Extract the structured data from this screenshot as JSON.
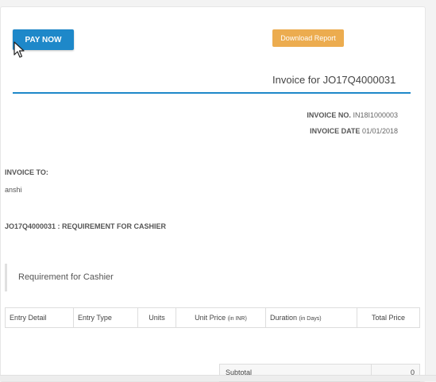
{
  "toolbar": {
    "pay_now_label": "PAY NOW",
    "download_label": "Download Report"
  },
  "invoice": {
    "title": "Invoice for JO17Q4000031",
    "number_label": "INVOICE NO.",
    "number_value": "IN18I1000003",
    "date_label": "INVOICE DATE",
    "date_value": "01/01/2018",
    "to_label": "INVOICE TO:",
    "to_value": "anshi",
    "job_line": "JO17Q4000031 : REQUIREMENT FOR CASHIER",
    "requirement_heading": "Requirement for Cashier"
  },
  "table": {
    "headers": [
      {
        "main": "Entry Detail",
        "sub": ""
      },
      {
        "main": "Entry Type",
        "sub": ""
      },
      {
        "main": "Units",
        "sub": ""
      },
      {
        "main": "Unit Price",
        "sub": "(in INR)"
      },
      {
        "main": "Duration",
        "sub": "(in Days)"
      },
      {
        "main": "Total Price",
        "sub": ""
      }
    ]
  },
  "summary": {
    "subtotal_label": "Subtotal",
    "subtotal_value": "0"
  },
  "colors": {
    "primary": "#1e88c9",
    "download": "#ecac4f"
  }
}
